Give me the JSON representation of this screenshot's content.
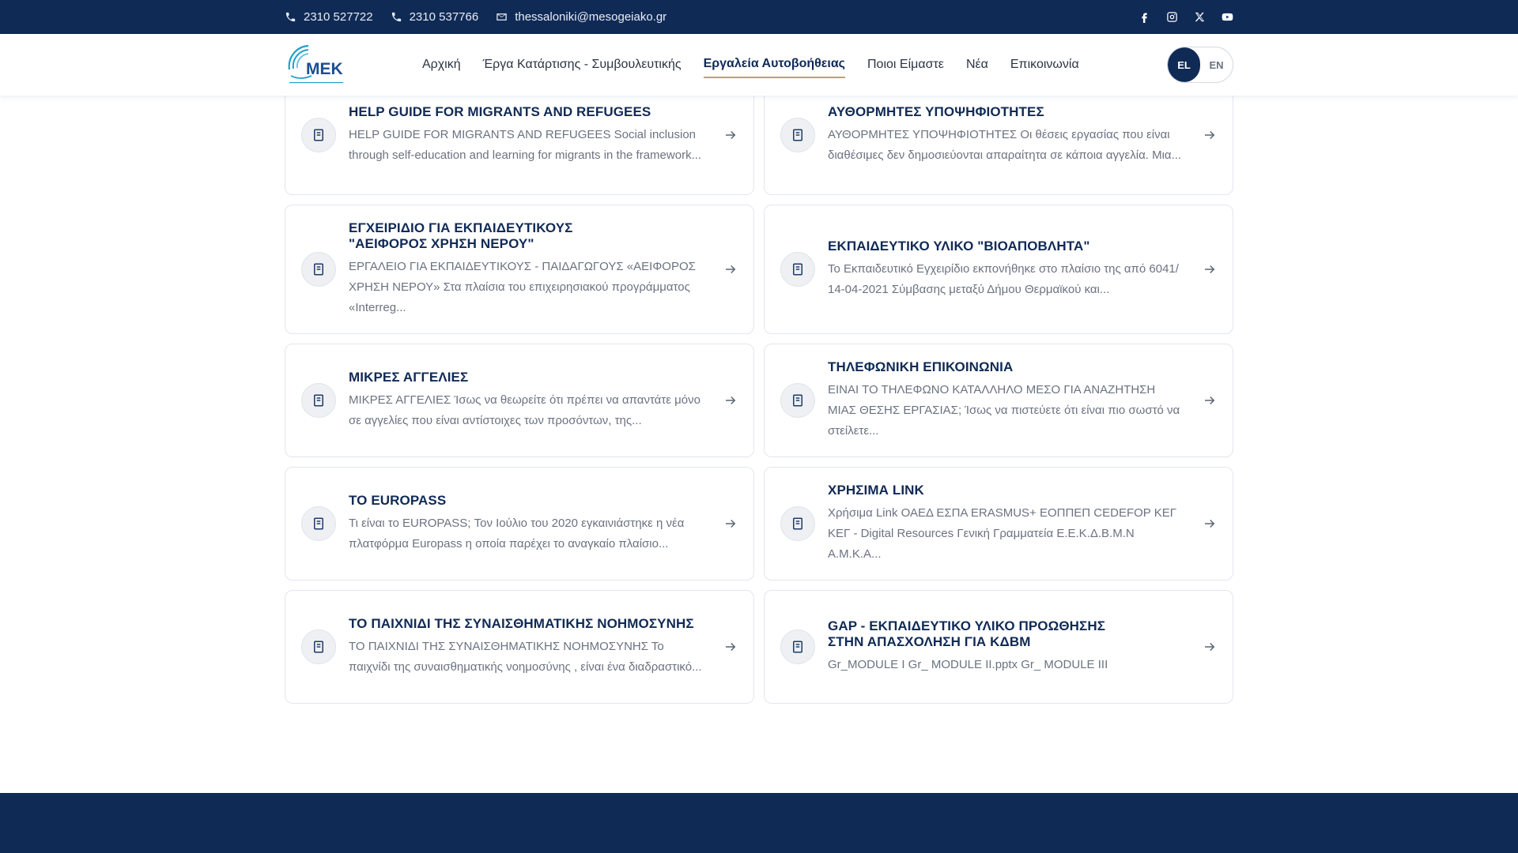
{
  "topbar": {
    "phone1": "2310 527722",
    "phone2": "2310 537766",
    "email": "thessaloniki@mesogeiako.gr",
    "socials": [
      "facebook-icon",
      "instagram-icon",
      "x-icon",
      "youtube-icon"
    ]
  },
  "header": {
    "logo_text": "MEK",
    "nav": [
      {
        "label": "Αρχική",
        "active": false
      },
      {
        "label": "Έργα Κατάρτισης - Συμβουλευτικής",
        "active": false
      },
      {
        "label": "Εργαλεία Αυτοβοήθειας",
        "active": true
      },
      {
        "label": "Ποιοι Είμαστε",
        "active": false
      },
      {
        "label": "Νέα",
        "active": false
      },
      {
        "label": "Επικοινωνία",
        "active": false
      }
    ],
    "lang": {
      "el": "EL",
      "en": "EN",
      "active": "EL"
    }
  },
  "colors": {
    "navy": "#102a56",
    "accent_underline": "#b8a27a",
    "muted_text": "#6b7280"
  },
  "cards": [
    {
      "title": "HELP GUIDE FOR MIGRANTS AND REFUGEES",
      "excerpt": "HELP GUIDE FOR MIGRANTS AND REFUGEES Social inclusion through self-education and learning for migrants in the framework..."
    },
    {
      "title": "ΑΥΘΟΡΜΗΤΕΣ ΥΠΟΨΗΦΙΟΤΗΤΕΣ",
      "excerpt": "ΑΥΘΟΡΜΗΤΕΣ ΥΠΟΨΗΦΙΟΤΗΤΕΣ Οι θέσεις εργασίας που είναι διαθέσιμες δεν δημοσιεύονται απαραίτητα σε κάποια αγγελία. Μια..."
    },
    {
      "title": "ΕΓΧΕΙΡΙΔΙΟ ΓΙΑ ΕΚΠΑΙΔΕΥΤΙΚΟΥΣ \"ΑΕΙΦΟΡΟΣ ΧΡΗΣΗ ΝΕΡΟΥ\"",
      "excerpt": "ΕΡΓΑΛΕΙΟ ΓΙΑ ΕΚΠΑΙΔΕΥΤΙΚΟΥΣ - ΠΑΙΔΑΓΩΓΟΥΣ «ΑΕΙΦΟΡΟΣ ΧΡΗΣΗ ΝΕΡΟΥ» Στα πλαίσια του επιχειρησιακού προγράμματος «Interreg..."
    },
    {
      "title": "ΕΚΠΑΙΔΕΥΤΙΚΟ ΥΛΙΚΟ \"ΒΙΟΑΠΟΒΛΗΤΑ\"",
      "excerpt": "Το Εκπαιδευτικό Εγχειρίδιο εκπονήθηκε στο πλαίσιο της από 6041/ 14-04-2021 Σύμβασης μεταξύ Δήμου Θερμαϊκού και..."
    },
    {
      "title": "ΜΙΚΡΕΣ ΑΓΓΕΛΙΕΣ",
      "excerpt": "ΜΙΚΡΕΣ ΑΓΓΕΛΙΕΣ Ίσως να θεωρείτε ότι πρέπει να απαντάτε μόνο σε αγγελίες που είναι αντίστοιχες των προσόντων, της..."
    },
    {
      "title": "ΤΗΛΕΦΩΝΙΚΗ ΕΠΙΚΟΙΝΩΝΙΑ",
      "excerpt": "ΕΙΝΑΙ ΤΟ ΤΗΛΕΦΩΝΟ ΚΑΤΑΛΛΗΛΟ ΜΕΣΟ ΓΙΑ ΑΝΑΖΗΤΗΣΗ ΜΙΑΣ ΘΕΣΗΣ ΕΡΓΑΣΙΑΣ; Ίσως να πιστεύετε ότι είναι πιο σωστό να στείλετε..."
    },
    {
      "title": "ΤΟ EUROPASS",
      "excerpt": "Τι είναι το EUROPASS; Τον Ιούλιο του 2020 εγκαινιάστηκε η νέα πλατφόρμα Europass η οποία παρέχει το αναγκαίο πλαίσιο..."
    },
    {
      "title": "ΧΡΗΣΙΜΑ LINK",
      "excerpt": "Χρήσιμα Link ΟΑΕΔ ΕΣΠΑ ERASMUS+ ΕΟΠΠΕΠ CEDEFOP ΚΕΓ ΚΕΓ - Digital Resources Γενική Γραμματεία Ε.Ε.Κ.Δ.Β.Μ.Ν Α.Μ.Κ.Α..."
    },
    {
      "title": "ΤΟ ΠΑΙΧΝΙΔΙ ΤΗΣ ΣΥΝΑΙΣΘΗΜΑΤΙΚΗΣ ΝΟΗΜΟΣΥΝΗΣ",
      "excerpt": "ΤΟ ΠΑΙΧΝΙΔΙ ΤΗΣ ΣΥΝΑΙΣΘΗΜΑΤΙΚΗΣ ΝΟΗΜΟΣΥΝΗΣ Το παιχνίδι της συναισθηματικής νοημοσύνης , είναι ένα διαδραστικό..."
    },
    {
      "title": "GAP - ΕΚΠΑΙΔΕΥΤΙΚΟ ΥΛΙΚΟ ΠΡΟΩΘΗΣΗΣ ΣΤΗΝ ΑΠΑΣΧΟΛΗΣΗ ΓΙΑ ΚΔΒΜ",
      "excerpt": "Gr_MODULE I Gr_ MODULE II.pptx Gr_ MODULE III"
    }
  ]
}
